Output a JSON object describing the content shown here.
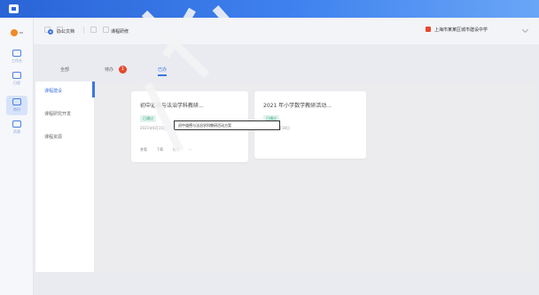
{
  "titlebar": {
    "text": ""
  },
  "header": {
    "username": "上海市某某区城市建设中学",
    "badge_color": "#e8472e"
  },
  "doc_tab": {
    "label": "办公文档",
    "second": "课程研修"
  },
  "subnav": {
    "items": [
      {
        "label": "全部"
      },
      {
        "label": "待办"
      },
      {
        "label": "已办"
      }
    ],
    "badge": "1"
  },
  "sidebar": {
    "items": [
      {
        "label": "课程建设"
      },
      {
        "label": "课程研究开发"
      },
      {
        "label": "课程资源"
      }
    ]
  },
  "rail": {
    "items": [
      {
        "label": "工作台",
        "icon": "grid-icon"
      },
      {
        "label": "日程",
        "icon": "calendar-icon"
      },
      {
        "label": "教研",
        "icon": "book-icon"
      },
      {
        "label": "资源",
        "icon": "folder-icon"
      }
    ]
  },
  "cards": [
    {
      "title": "初中道德与法治学科教研...",
      "tag": "已通过",
      "meta": "2021年6月15日",
      "actions": [
        "查看",
        "下载",
        "分享",
        "···"
      ]
    },
    {
      "title": "2021 年小学数学教研活动...",
      "tag": "已通过",
      "meta": "2021年6月18日",
      "actions": []
    }
  ],
  "tooltip": "初中道德与法治学科教研活动方案",
  "colors": {
    "accent": "#3b76e0",
    "titlebar": "#2a64d6",
    "tag": "#2aa57a"
  }
}
